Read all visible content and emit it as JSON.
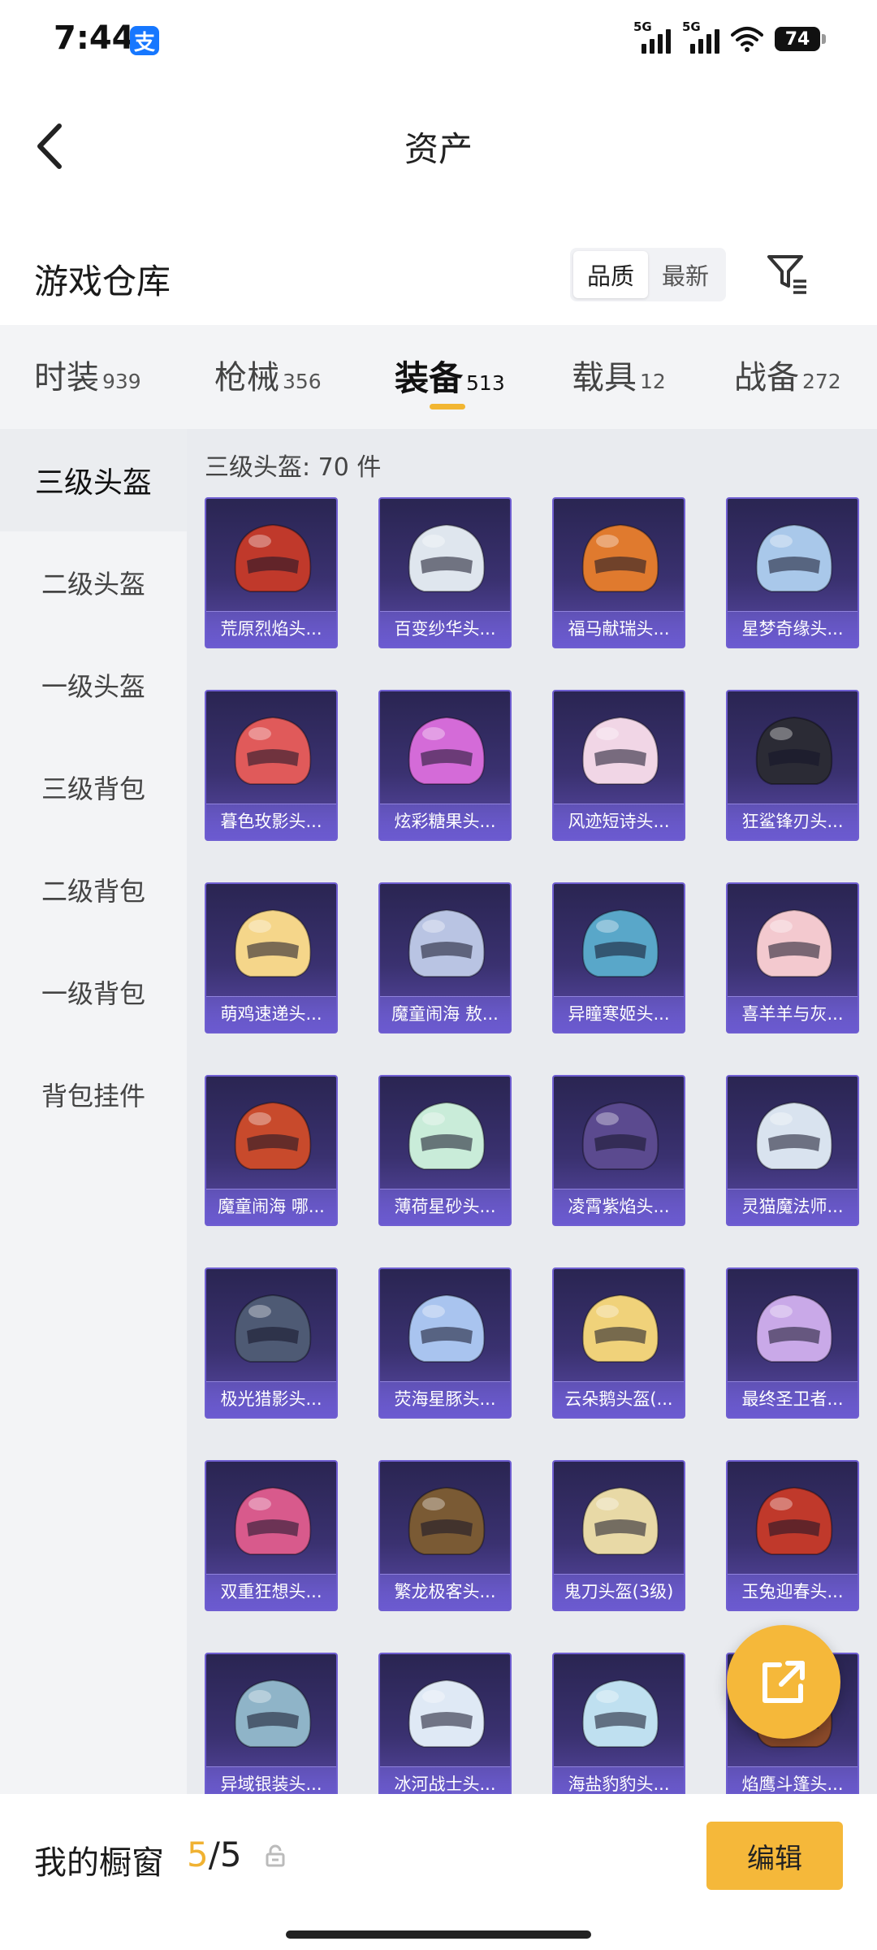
{
  "status": {
    "time": "7:44",
    "alipay": "支",
    "network1": "5G",
    "network2": "5G",
    "battery": "74"
  },
  "header": {
    "title": "资产"
  },
  "warehouse": {
    "title": "游戏仓库",
    "sort_options": [
      {
        "label": "品质",
        "active": true
      },
      {
        "label": "最新",
        "active": false
      }
    ]
  },
  "tabs": [
    {
      "label": "时装",
      "count": "939",
      "active": false
    },
    {
      "label": "枪械",
      "count": "356",
      "active": false
    },
    {
      "label": "装备",
      "count": "513",
      "active": true
    },
    {
      "label": "载具",
      "count": "12",
      "active": false
    },
    {
      "label": "战备",
      "count": "272",
      "active": false
    }
  ],
  "menu": [
    {
      "label": "三级头盔",
      "active": true
    },
    {
      "label": "二级头盔",
      "active": false
    },
    {
      "label": "一级头盔",
      "active": false
    },
    {
      "label": "三级背包",
      "active": false
    },
    {
      "label": "二级背包",
      "active": false
    },
    {
      "label": "一级背包",
      "active": false
    },
    {
      "label": "背包挂件",
      "active": false
    }
  ],
  "section": {
    "count_text": "三级头盔: 70 件"
  },
  "items": [
    {
      "name": "荒原烈焰头...",
      "color": "#c0392b"
    },
    {
      "name": "百变纱华头...",
      "color": "#dfe6ee"
    },
    {
      "name": "福马献瑞头...",
      "color": "#e07a2e"
    },
    {
      "name": "星梦奇缘头...",
      "color": "#a9c8ea"
    },
    {
      "name": "暮色玫影头...",
      "color": "#e05a5a"
    },
    {
      "name": "炫彩糖果头...",
      "color": "#d46bd8"
    },
    {
      "name": "风迹短诗头...",
      "color": "#f1d6e6"
    },
    {
      "name": "狂鲨锋刃头...",
      "color": "#2b2b35"
    },
    {
      "name": "萌鸡速递头...",
      "color": "#f5d68a"
    },
    {
      "name": "魔童闹海 敖...",
      "color": "#b9c4e3"
    },
    {
      "name": "异瞳寒姬头...",
      "color": "#59a7c9"
    },
    {
      "name": "喜羊羊与灰...",
      "color": "#f3c9cf"
    },
    {
      "name": "魔童闹海 哪...",
      "color": "#c84a2c"
    },
    {
      "name": "薄荷星砂头...",
      "color": "#c9ecd9"
    },
    {
      "name": "凌霄紫焰头...",
      "color": "#5b4a8f"
    },
    {
      "name": "灵猫魔法师...",
      "color": "#d9e3ef"
    },
    {
      "name": "极光猎影头...",
      "color": "#4e5a74"
    },
    {
      "name": "荧海星豚头...",
      "color": "#a9c4ef"
    },
    {
      "name": "云朵鹅头盔(...",
      "color": "#f0d27a"
    },
    {
      "name": "最终圣卫者...",
      "color": "#c9a9e8"
    },
    {
      "name": "双重狂想头...",
      "color": "#d85a8c"
    },
    {
      "name": "繁龙极客头...",
      "color": "#7a5a34"
    },
    {
      "name": "鬼刀头盔(3级)",
      "color": "#e8d9a6"
    },
    {
      "name": "玉兔迎春头...",
      "color": "#c0392b"
    },
    {
      "name": "异域银装头...",
      "color": "#8fb4c8"
    },
    {
      "name": "冰河战士头...",
      "color": "#dfe9f5"
    },
    {
      "name": "海盐豹豹头...",
      "color": "#bfe0f0"
    },
    {
      "name": "焰鹰斗篷头...",
      "color": "#8a4a2a"
    }
  ],
  "bottom": {
    "label": "我的橱窗",
    "current": "5",
    "separator": "/",
    "total": "5",
    "edit_label": "编辑"
  },
  "colors": {
    "accent": "#f5b83a",
    "card_border": "#6f5ed1"
  }
}
